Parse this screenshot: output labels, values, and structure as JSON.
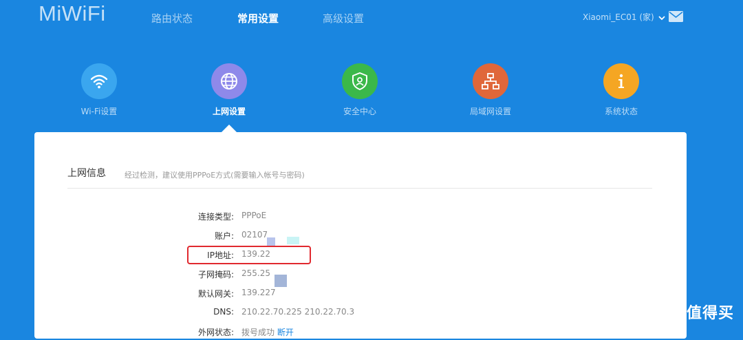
{
  "header": {
    "logo": "MiWiFi",
    "nav": [
      {
        "label": "路由状态",
        "active": false
      },
      {
        "label": "常用设置",
        "active": true
      },
      {
        "label": "高级设置",
        "active": false
      }
    ],
    "device_name": "Xiaomi_EC01 (家)",
    "mail_icon": "mail-icon"
  },
  "features": [
    {
      "label": "Wi-Fi设置",
      "icon": "wifi-icon",
      "color": "#3aa6ef",
      "active": false
    },
    {
      "label": "上网设置",
      "icon": "globe-icon",
      "color": "#8e89ea",
      "active": true
    },
    {
      "label": "安全中心",
      "icon": "shield-icon",
      "color": "#3bb84a",
      "active": false
    },
    {
      "label": "局域网设置",
      "icon": "network-icon",
      "color": "#e0673a",
      "active": false
    },
    {
      "label": "系统状态",
      "icon": "info-icon",
      "color": "#f5a623",
      "active": false
    }
  ],
  "section": {
    "title": "上网信息",
    "description": "经过检测，建议使用PPPoE方式(需要输入帐号与密码)"
  },
  "info": {
    "connection_type": {
      "label": "连接类型:",
      "value": "PPPoE"
    },
    "account": {
      "label": "账户:",
      "value": "02107"
    },
    "ip": {
      "label": "IP地址:",
      "value": "139.22"
    },
    "subnet": {
      "label": "子网掩码:",
      "value": "255.25"
    },
    "gateway": {
      "label": "默认网关:",
      "value": "139.227"
    },
    "dns": {
      "label": "DNS:",
      "value": "210.22.70.225 210.22.70.3"
    },
    "external": {
      "label": "外网状态:",
      "value": "拨号成功",
      "action": "断开"
    }
  },
  "watermark": {
    "text": "什么值得买",
    "icon": "zhi-icon"
  }
}
